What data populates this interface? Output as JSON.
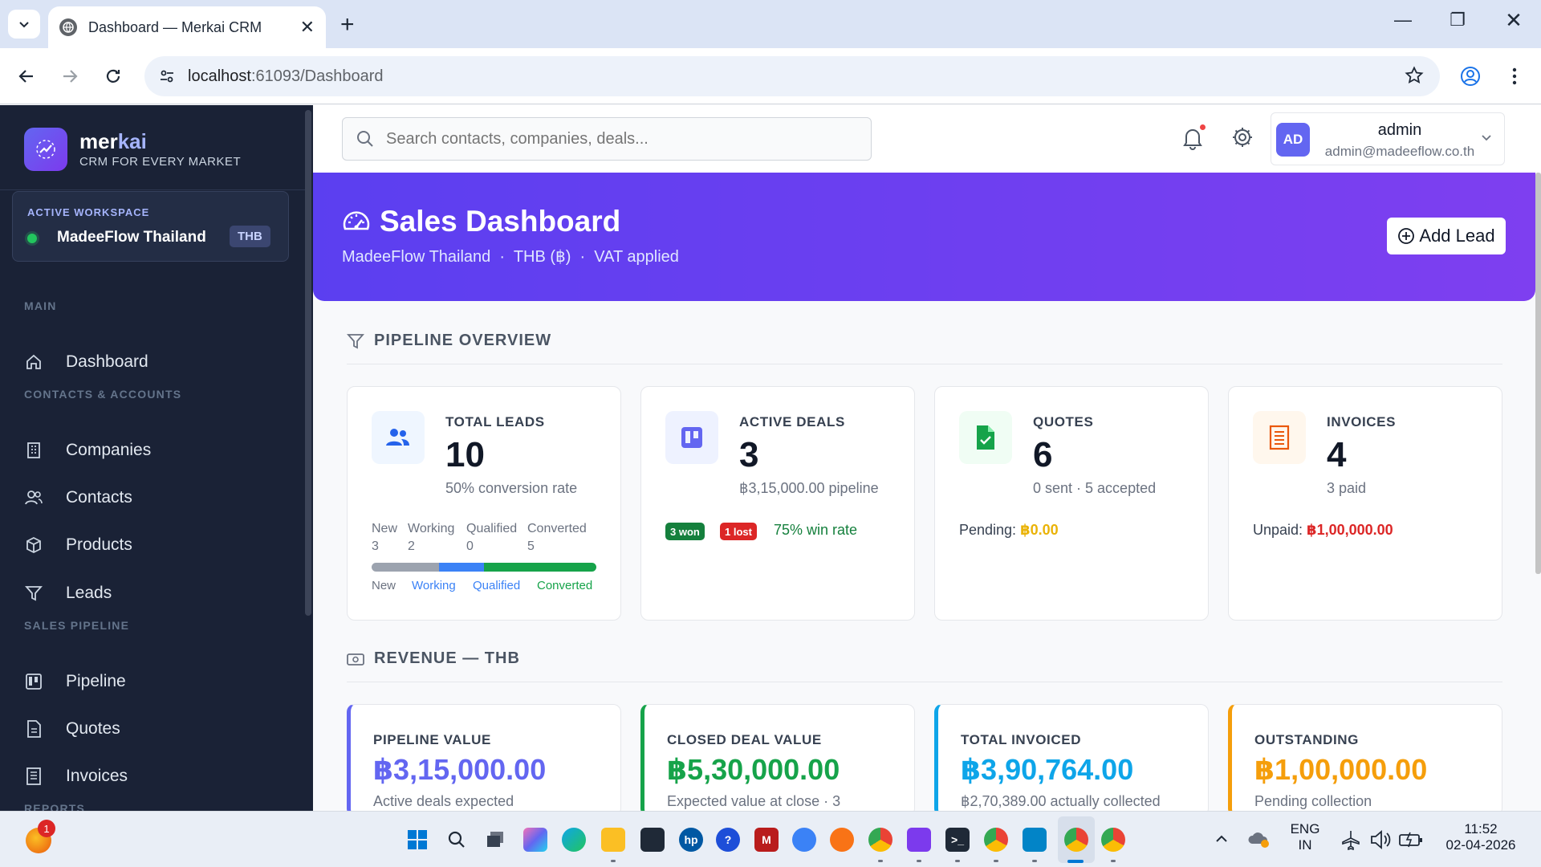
{
  "browser": {
    "tab_title": "Dashboard — Merkai CRM",
    "url_host": "localhost",
    "url_path": ":61093/Dashboard"
  },
  "sidebar": {
    "brand_name_a": "mer",
    "brand_name_b": "kai",
    "brand_tagline": "CRM FOR EVERY MARKET",
    "workspace_label": "ACTIVE WORKSPACE",
    "workspace_name": "MadeeFlow Thailand",
    "workspace_currency": "THB",
    "sections": {
      "main": "MAIN",
      "contacts": "CONTACTS & ACCOUNTS",
      "sales": "SALES PIPELINE",
      "reports": "REPORTS"
    },
    "items": {
      "dashboard": "Dashboard",
      "companies": "Companies",
      "contacts": "Contacts",
      "products": "Products",
      "leads": "Leads",
      "pipeline": "Pipeline",
      "quotes": "Quotes",
      "invoices": "Invoices"
    }
  },
  "topbar": {
    "search_placeholder": "Search contacts, companies, deals...",
    "avatar_initials": "AD",
    "user_name": "admin",
    "user_email": "admin@madeeflow.co.th"
  },
  "hero": {
    "title": "Sales Dashboard",
    "subtitle": "MadeeFlow Thailand  ·  THB (฿)  ·  VAT applied",
    "add_lead_label": "Add Lead"
  },
  "pipeline_overview": {
    "heading": "PIPELINE OVERVIEW",
    "total_leads": {
      "label": "TOTAL LEADS",
      "value": "10",
      "sub": "50% conversion rate",
      "stages": [
        {
          "name": "New",
          "count": "3",
          "color": "#9ca3af"
        },
        {
          "name": "Working",
          "count": "2",
          "color": "#3b82f6"
        },
        {
          "name": "Qualified",
          "count": "0",
          "color": "#0ea5e9"
        },
        {
          "name": "Converted",
          "count": "5",
          "color": "#16a34a"
        }
      ],
      "legend": {
        "new": "New",
        "working": "Working",
        "qualified": "Qualified",
        "converted": "Converted"
      }
    },
    "active_deals": {
      "label": "ACTIVE DEALS",
      "value": "3",
      "sub": "฿3,15,000.00 pipeline",
      "won_badge": "3 won",
      "lost_badge": "1 lost",
      "win_rate": "75% win rate"
    },
    "quotes": {
      "label": "QUOTES",
      "value": "6",
      "sub": "0 sent · 5 accepted",
      "pending_label": "Pending: ",
      "pending_value": "฿0.00"
    },
    "invoices": {
      "label": "INVOICES",
      "value": "4",
      "sub": "3 paid",
      "unpaid_label": "Unpaid: ",
      "unpaid_value": "฿1,00,000.00"
    }
  },
  "revenue": {
    "heading": "REVENUE — THB",
    "cards": [
      {
        "label": "PIPELINE VALUE",
        "value": "฿3,15,000.00",
        "sub": "Active deals expected",
        "color": "#6366f1"
      },
      {
        "label": "CLOSED DEAL VALUE",
        "value": "฿5,30,000.00",
        "sub": "Expected value at close · 3",
        "color": "#16a34a"
      },
      {
        "label": "TOTAL INVOICED",
        "value": "฿3,90,764.00",
        "sub": "฿2,70,389.00 actually collected",
        "color": "#0ea5e9"
      },
      {
        "label": "OUTSTANDING",
        "value": "฿1,00,000.00",
        "sub": "Pending collection",
        "color": "#f59e0b"
      }
    ]
  },
  "taskbar": {
    "notification_count": "1",
    "lang_line1": "ENG",
    "lang_line2": "IN",
    "time": "11:52",
    "date": "02-04-2026"
  }
}
